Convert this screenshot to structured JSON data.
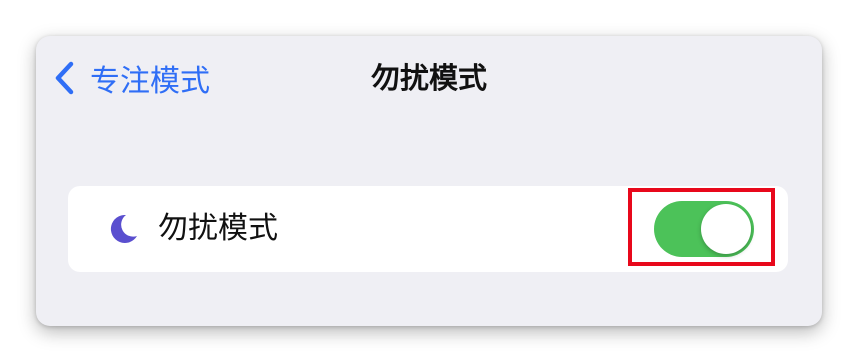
{
  "nav": {
    "back_label": "专注模式",
    "back_icon": "chevron-left-icon",
    "title": "勿扰模式"
  },
  "settings_row": {
    "icon": "moon-icon",
    "icon_color": "#5a4fcf",
    "label": "勿扰模式",
    "toggle": {
      "state": "on",
      "color": "#4cc259"
    }
  },
  "annotation": {
    "highlight_color": "#e8081b",
    "target": "do-not-disturb-toggle"
  },
  "colors": {
    "accent": "#2f6ef6",
    "background": "#efeff4"
  }
}
